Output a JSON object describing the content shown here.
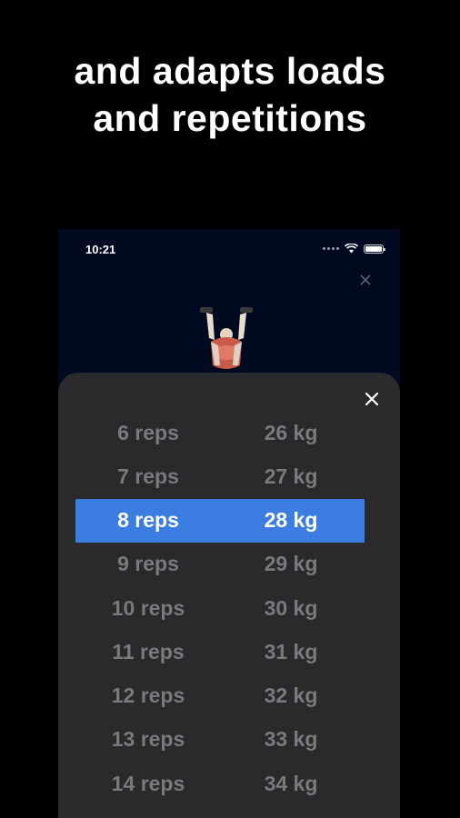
{
  "headline": {
    "line1": "and adapts loads",
    "line2": "and repetitions"
  },
  "status_bar": {
    "time": "10:21",
    "icons": [
      "cellular-signal-icon",
      "wifi-icon",
      "battery-icon"
    ]
  },
  "colors": {
    "background": "#000000",
    "app_background": "#020a22",
    "sheet_background": "#2a2a2c",
    "selected_row": "#3b7de0",
    "inactive_text": "#7a7a7e"
  },
  "picker": {
    "selected_index": 2,
    "rows": [
      {
        "reps": "6 reps",
        "load": "26 kg"
      },
      {
        "reps": "7 reps",
        "load": "27 kg"
      },
      {
        "reps": "8 reps",
        "load": "28 kg"
      },
      {
        "reps": "9 reps",
        "load": "29 kg"
      },
      {
        "reps": "10 reps",
        "load": "30 kg"
      },
      {
        "reps": "11 reps",
        "load": "31 kg"
      },
      {
        "reps": "12 reps",
        "load": "32 kg"
      },
      {
        "reps": "13 reps",
        "load": "33 kg"
      },
      {
        "reps": "14 reps",
        "load": "34 kg"
      }
    ]
  }
}
